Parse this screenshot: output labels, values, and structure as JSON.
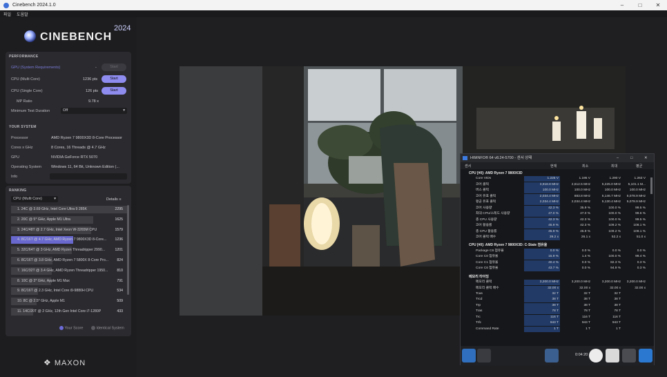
{
  "window": {
    "title": "Cinebench 2024.1.0",
    "menu": [
      "파일",
      "도움말"
    ]
  },
  "brand": {
    "name": "CINEBENCH",
    "year": "2024",
    "footer": "MAXON"
  },
  "performance": {
    "title": "PERFORMANCE",
    "gpu_label": "GPU (System Requirements)",
    "gpu_value": "-",
    "gpu_button": "Start",
    "multi_label": "CPU (Multi Core)",
    "multi_value": "1236 pts",
    "multi_button": "Start",
    "single_label": "CPU (Single Core)",
    "single_value": "126 pts",
    "single_button": "Start",
    "ratio_label": "MP Ratio",
    "ratio_value": "9.78 x",
    "duration_label": "Minimum Test Duration",
    "duration_value": "Off"
  },
  "system": {
    "title": "YOUR SYSTEM",
    "rows": [
      {
        "label": "Processor",
        "value": "AMD Ryzen 7 9800X3D 8-Core Processor"
      },
      {
        "label": "Cores x GHz",
        "value": "8 Cores, 16 Threads @ 4.7 GHz"
      },
      {
        "label": "GPU",
        "value": "NVIDIA GeForce RTX 5070"
      },
      {
        "label": "Operating System",
        "value": "Windows 11, 64 Bit, Unknown Edition (..."
      },
      {
        "label": "Info",
        "value": ""
      }
    ]
  },
  "ranking": {
    "title": "RANKING",
    "dropdown": "CPU (Multi Core)",
    "details": "Details",
    "items": [
      {
        "label": "1. 24C @ 3.69 GHz, Intel Core Ultra 9 285K",
        "score": "2295",
        "pct": 1.0,
        "mine": false
      },
      {
        "label": "2. 20C @ 5* GHz, Apple M1 Ultra",
        "score": "1625",
        "pct": 0.708,
        "mine": false
      },
      {
        "label": "3. 24C/48T @ 2.7 GHz, Intel Xeon W-3265M CPU",
        "score": "1579",
        "pct": 0.688,
        "mine": false
      },
      {
        "label": "4. 8C/16T @ 4.7 GHz, AMD Ryzen 7 9800X3D 8-Core...",
        "score": "1236",
        "pct": 0.538,
        "mine": true
      },
      {
        "label": "5. 32C/64T @ 3 GHz, AMD Ryzen Threadripper 2990...",
        "score": "1201",
        "pct": 0.523,
        "mine": false
      },
      {
        "label": "6. 8C/16T @ 3.8 GHz, AMD Ryzen 7 5800X 8-Core Pro...",
        "score": "824",
        "pct": 0.359,
        "mine": false
      },
      {
        "label": "7. 16C/32T @ 3.4 GHz, AMD Ryzen Threadripper 1950...",
        "score": "810",
        "pct": 0.353,
        "mine": false
      },
      {
        "label": "8. 10C @ 3* GHz, Apple M1 Max",
        "score": "791",
        "pct": 0.345,
        "mine": false
      },
      {
        "label": "9. 8C/16T @ 2.3 GHz, Intel Core i9-9880H CPU",
        "score": "534",
        "pct": 0.233,
        "mine": false
      },
      {
        "label": "10. 8C @ 2.5* GHz, Apple M1",
        "score": "509",
        "pct": 0.222,
        "mine": false
      },
      {
        "label": "11. 14C/20T @ 2 GHz, 12th Gen Intel Core i7-1280P",
        "score": "433",
        "pct": 0.189,
        "mine": false
      }
    ],
    "legend_your": "Your Score",
    "legend_identical": "Identical System"
  },
  "hwinfo": {
    "title": "HWiNFO® 64 v8.24-5700 - 센서 상태",
    "headers": [
      "센서",
      "현재",
      "최소",
      "최대",
      "평균"
    ],
    "sections": [
      {
        "title": "CPU [#0]: AMD Ryzen 7 9800X3D",
        "rows": [
          {
            "name": "Core VIDs",
            "v": [
              "1.225 V",
              "1.195 V",
              "1.290 V",
              "1.263 V"
            ]
          },
          {
            "name": "코어 클럭",
            "v": [
              "3,918.8 MHz",
              "2,612.5 MHz",
              "5,225.0 MHz",
              "5,101.1 M..."
            ]
          },
          {
            "name": "버스 클럭",
            "v": [
              "100.0 MHz",
              "100.0 MHz",
              "100.0 MHz",
              "100.0 MHz"
            ]
          },
          {
            "name": "코어 유효 클럭",
            "v": [
              "2,034.4 MHz",
              "883.8 MHz",
              "5,146.7 MHz",
              "5,078.9 MHz"
            ]
          },
          {
            "name": "평균 유효 클럭",
            "v": [
              "2,034.4 MHz",
              "2,034.4 MHz",
              "5,130.4 MHz",
              "5,078.9 MHz"
            ]
          },
          {
            "name": "코어 사용량",
            "v": [
              "42.3 %",
              "35.9 %",
              "100.0 %",
              "99.5 %"
            ]
          },
          {
            "name": "최대 CPU/스레드 사용량",
            "v": [
              "47.0 %",
              "47.0 %",
              "100.0 %",
              "99.6 %"
            ]
          },
          {
            "name": "총 CPU 사용량",
            "v": [
              "42.3 %",
              "42.3 %",
              "100.0 %",
              "99.5 %"
            ]
          },
          {
            "name": "코어 활용률",
            "v": [
              "45.9 %",
              "42.3 %",
              "109.2 %",
              "108.1 %"
            ]
          },
          {
            "name": "총 CPU 활용률",
            "v": [
              "45.9 %",
              "45.9 %",
              "109.2 %",
              "108.1 %"
            ]
          },
          {
            "name": "코어 클럭 배수",
            "v": [
              "39.2 x",
              "26.1 x",
              "52.2 x",
              "51.0 x"
            ]
          }
        ]
      },
      {
        "title": "CPU [#0]: AMD Ryzen 7 9800X3D: C-State 점유율",
        "rows": [
          {
            "name": "Package C6 점유율",
            "v": [
              "0.0 %",
              "0.0 %",
              "0.0 %",
              "0.0 %"
            ]
          },
          {
            "name": "Core C0 점유율",
            "v": [
              "15.9 %",
              "1.4 %",
              "100.0 %",
              "99.4 %"
            ]
          },
          {
            "name": "Core C1 점유율",
            "v": [
              "40.4 %",
              "0.0 %",
              "82.3 %",
              "0.3 %"
            ]
          },
          {
            "name": "Core C6 점유율",
            "v": [
              "43.7 %",
              "0.0 %",
              "94.9 %",
              "0.3 %"
            ]
          }
        ]
      },
      {
        "title": "메모리 타이밍",
        "rows": [
          {
            "name": "메모리 클럭",
            "v": [
              "3,200.0 MHz",
              "3,200.0 MHz",
              "3,200.0 MHz",
              "3,200.0 MHz"
            ]
          },
          {
            "name": "메모리 클럭 배수",
            "v": [
              "32.00 x",
              "32.00 x",
              "32.00 x",
              "32.00 x"
            ]
          },
          {
            "name": "Tcas",
            "v": [
              "32 T",
              "32 T",
              "32 T",
              ""
            ]
          },
          {
            "name": "Trcd",
            "v": [
              "38 T",
              "38 T",
              "38 T",
              ""
            ]
          },
          {
            "name": "Trp",
            "v": [
              "38 T",
              "38 T",
              "38 T",
              ""
            ]
          },
          {
            "name": "Tras",
            "v": [
              "78 T",
              "78 T",
              "78 T",
              ""
            ]
          },
          {
            "name": "Trc",
            "v": [
              "116 T",
              "116 T",
              "116 T",
              ""
            ]
          },
          {
            "name": "Trfc",
            "v": [
              "943 T",
              "943 T",
              "943 T",
              ""
            ]
          },
          {
            "name": "Command Rate",
            "v": [
              "1 T",
              "1 T",
              "1 T",
              ""
            ]
          }
        ]
      }
    ],
    "elapsed": "0:04:20"
  }
}
